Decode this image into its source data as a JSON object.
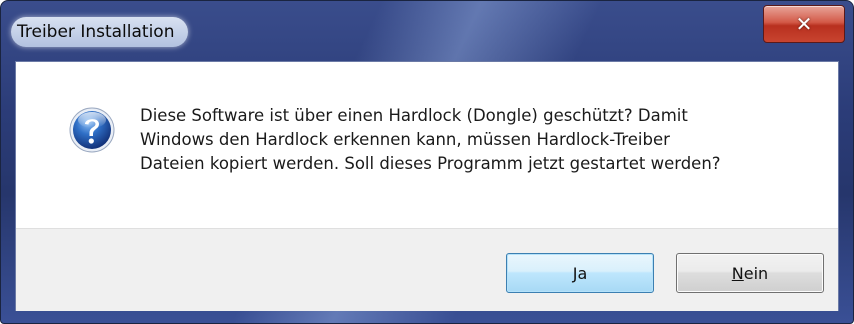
{
  "window": {
    "title": "Treiber Installation",
    "close_glyph": "✕"
  },
  "dialog": {
    "icon": "question-icon",
    "message_lines": [
      "Diese Software ist über einen Hardlock (Dongle) geschützt? Damit",
      "Windows den Hardlock erkennen kann, müssen Hardlock-Treiber",
      "Dateien kopiert werden. Soll dieses Programm jetzt gestartet werden?"
    ]
  },
  "buttons": {
    "yes_label": "Ja",
    "no_label_mnemonic": "N",
    "no_label_rest": "ein"
  },
  "colors": {
    "frame": "#2b3c78",
    "close_button": "#c8442f",
    "default_button_border": "#3c7fb1",
    "button_bar": "#f0f0f0"
  }
}
